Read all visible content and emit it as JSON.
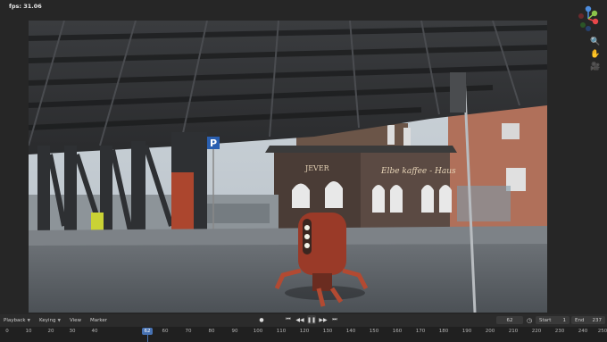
{
  "viewport": {
    "fps_label": "fps: 31.06",
    "scene_sign_text": "Elbe kaffee - Haus",
    "scene_sign_small": "JEVER",
    "parking_sign": "P",
    "gizmo_labels": {
      "x": "X",
      "y": "Y",
      "z": "Z"
    },
    "nav_icons": [
      "zoom-icon",
      "hand-pan-icon",
      "camera-icon"
    ]
  },
  "timeline": {
    "menus": [
      "Playback",
      "Keying",
      "View",
      "Marker"
    ],
    "current_frame": "62",
    "start_label": "Start",
    "start_value": "1",
    "end_label": "End",
    "end_value": "237",
    "accent": "#4772b3"
  },
  "ruler": {
    "ticks": [
      "0",
      "10",
      "20",
      "30",
      "40",
      "60",
      "70",
      "80",
      "90",
      "100",
      "110",
      "120",
      "130",
      "140",
      "150",
      "160",
      "170",
      "180",
      "190",
      "200",
      "210",
      "220",
      "230",
      "240",
      "250"
    ],
    "current": "62"
  }
}
